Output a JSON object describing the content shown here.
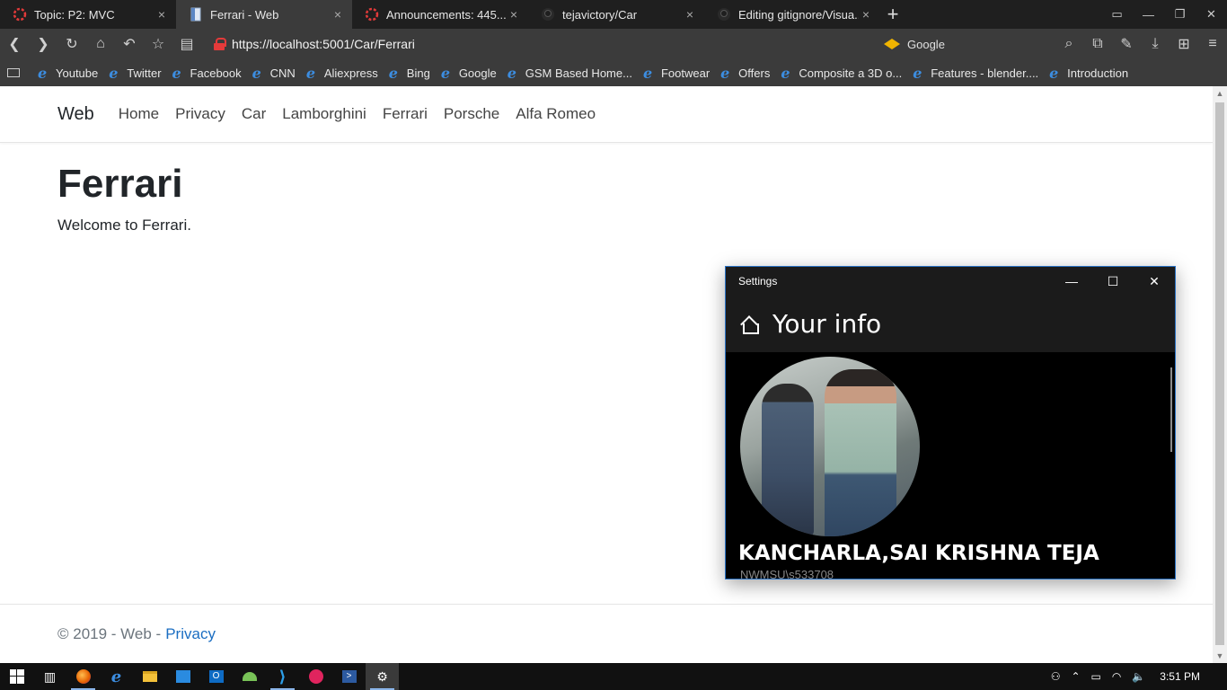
{
  "browser": {
    "tabs": [
      {
        "title": "Topic: P2: MVC",
        "close": "×",
        "icon": "canvas-icon"
      },
      {
        "title": "Ferrari - Web",
        "close": "×",
        "icon": "page-icon",
        "active": true
      },
      {
        "title": "Announcements: 445...",
        "close": "×",
        "icon": "canvas-icon"
      },
      {
        "title": "tejavictory/Car",
        "close": "×",
        "icon": "github-icon"
      },
      {
        "title": "Editing gitignore/Visua...",
        "close": "×",
        "icon": "github-icon"
      }
    ],
    "new_tab": "+",
    "url": "https://localhost:5001/Car/Ferrari",
    "search_engine": "Google",
    "bookmarks": [
      "Youtube",
      "Twitter",
      "Facebook",
      "CNN",
      "Aliexpress",
      "Bing",
      "Google",
      "GSM Based Home...",
      "Footwear",
      "Offers",
      "Composite a 3D o...",
      "Features - blender....",
      "Introduction"
    ]
  },
  "site": {
    "brand": "Web",
    "nav": [
      "Home",
      "Privacy",
      "Car",
      "Lamborghini",
      "Ferrari",
      "Porsche",
      "Alfa Romeo"
    ],
    "heading": "Ferrari",
    "welcome": "Welcome to Ferrari.",
    "footer_text": "© 2019 - Web -",
    "footer_link": "Privacy",
    "link_color": "#1b6ec2"
  },
  "settings": {
    "window_title": "Settings",
    "heading": "Your info",
    "name": "KANCHARLA,SAI KRISHNA TEJA",
    "account": "NWMSU\\s533708",
    "accent": "#2a72c4"
  },
  "taskbar": {
    "clock": "3:51 PM"
  }
}
